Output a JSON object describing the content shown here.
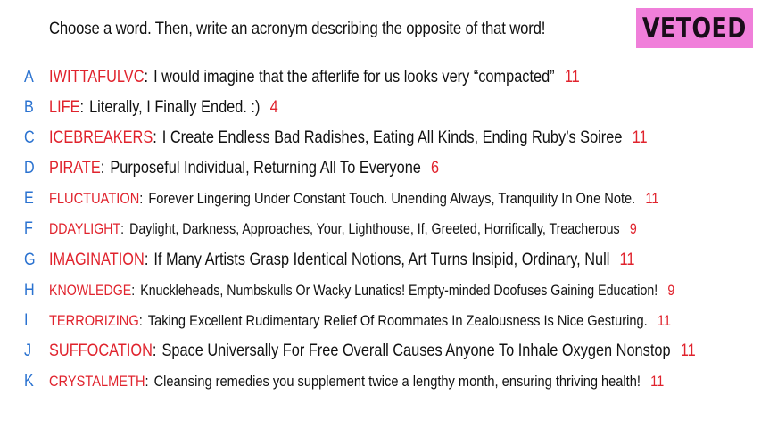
{
  "prompt": "Choose a word. Then, write an acronym describing the opposite of that word!",
  "status_badge": "VETOED",
  "entries": [
    {
      "letter": "A",
      "word": "IWITTAFULVC",
      "definition": "I would imagine that the afterlife for us looks very “compacted”",
      "count": "11"
    },
    {
      "letter": "B",
      "word": "LIFE",
      "definition": "Literally, I Finally Ended. :)",
      "count": "4"
    },
    {
      "letter": "C",
      "word": "ICEBREAKERS",
      "definition": "I Create Endless Bad Radishes, Eating All Kinds, Ending Ruby’s Soiree",
      "count": "11"
    },
    {
      "letter": "D",
      "word": "PIRATE",
      "definition": "Purposeful Individual, Returning All To Everyone",
      "count": "6"
    },
    {
      "letter": "E",
      "word": "FLUCTUATION",
      "definition": "Forever Lingering Under Constant Touch. Unending Always, Tranquility In One Note.",
      "count": "11"
    },
    {
      "letter": "F",
      "word": "DDAYLIGHT",
      "definition": "Daylight, Darkness, Approaches, Your, Lighthouse, If, Greeted, Horrifically, Treacherous",
      "count": "9"
    },
    {
      "letter": "G",
      "word": "IMAGINATION",
      "definition": "If Many Artists Grasp Identical Notions, Art Turns Insipid, Ordinary, Null",
      "count": "11"
    },
    {
      "letter": "H",
      "word": "KNOWLEDGE",
      "definition": "Knuckleheads, Numbskulls Or Wacky Lunatics! Empty-minded Doofuses Gaining Education!",
      "count": "9"
    },
    {
      "letter": "I",
      "word": "TERRORIZING",
      "definition": "Taking Excellent Rudimentary Relief Of Roommates In Zealousness Is Nice Gesturing.",
      "count": "11"
    },
    {
      "letter": "J",
      "word": "SUFFOCATION",
      "definition": "Space Universally For Free Overall Causes Anyone To Inhale Oxygen Nonstop",
      "count": "11"
    },
    {
      "letter": "K",
      "word": "CRYSTALMETH",
      "definition": "Cleansing remedies you supplement twice a lengthy month, ensuring thriving health!",
      "count": "11"
    }
  ],
  "colors": {
    "letter": "#2a72d0",
    "word": "#e0232d",
    "count": "#e0232d",
    "badge_bg": "#f07fda"
  }
}
